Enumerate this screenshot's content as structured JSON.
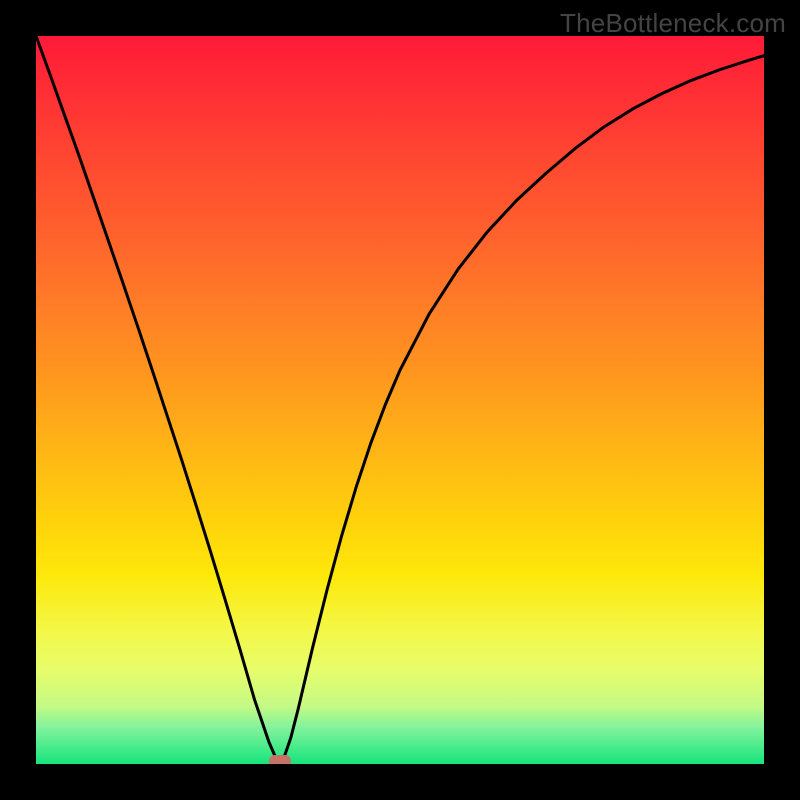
{
  "watermark": {
    "text": "TheBottleneck.com"
  },
  "chart_data": {
    "type": "line",
    "title": "",
    "xlabel": "",
    "ylabel": "",
    "xlim": [
      0,
      1
    ],
    "ylim": [
      0,
      1
    ],
    "series": [
      {
        "name": "bottleneck-curve",
        "x": [
          0.0,
          0.02,
          0.04,
          0.06,
          0.08,
          0.1,
          0.12,
          0.14,
          0.16,
          0.18,
          0.2,
          0.22,
          0.24,
          0.26,
          0.28,
          0.3,
          0.32,
          0.33,
          0.34,
          0.35,
          0.36,
          0.38,
          0.4,
          0.42,
          0.44,
          0.46,
          0.48,
          0.5,
          0.54,
          0.58,
          0.62,
          0.66,
          0.7,
          0.74,
          0.78,
          0.82,
          0.86,
          0.9,
          0.94,
          0.98,
          1.0
        ],
        "y": [
          1.0,
          0.945,
          0.889,
          0.833,
          0.775,
          0.717,
          0.659,
          0.6,
          0.54,
          0.479,
          0.418,
          0.355,
          0.291,
          0.225,
          0.158,
          0.089,
          0.03,
          0.007,
          0.007,
          0.036,
          0.075,
          0.16,
          0.24,
          0.314,
          0.381,
          0.441,
          0.494,
          0.541,
          0.618,
          0.68,
          0.731,
          0.774,
          0.811,
          0.845,
          0.875,
          0.9,
          0.921,
          0.939,
          0.954,
          0.967,
          0.973
        ]
      }
    ],
    "marker": {
      "x": 0.335,
      "y": 0.004,
      "color": "#c77267"
    },
    "background_gradient_stops": [
      {
        "pos": 0.0,
        "color": "#ff1a37"
      },
      {
        "pos": 0.5,
        "color": "#ffa51a"
      },
      {
        "pos": 0.8,
        "color": "#f3f84a"
      },
      {
        "pos": 1.0,
        "color": "#16e47c"
      }
    ]
  }
}
